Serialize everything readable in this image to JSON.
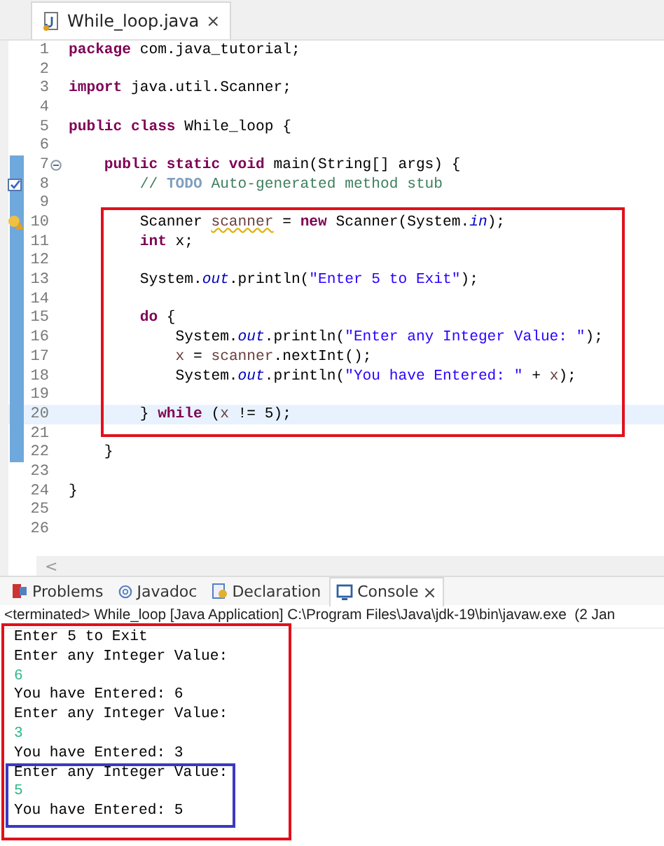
{
  "editor_tab": {
    "label": "While_loop.java",
    "close": "×"
  },
  "code_lines": [
    {
      "number": "1",
      "current": false,
      "kind": "code",
      "tokens": [
        {
          "kind": "kw",
          "text": "package"
        },
        {
          "kind": "plain",
          "text": " com.java_tutorial;"
        }
      ]
    },
    {
      "number": "2",
      "current": false,
      "kind": "code"
    },
    {
      "number": "3",
      "current": false,
      "kind": "code",
      "tokens": [
        {
          "kind": "kw",
          "text": "import"
        },
        {
          "kind": "plain",
          "text": " java.util.Scanner;"
        }
      ]
    },
    {
      "number": "4",
      "current": false,
      "kind": "code"
    },
    {
      "number": "5",
      "current": false,
      "kind": "code",
      "tokens": [
        {
          "kind": "kw",
          "text": "public class"
        },
        {
          "kind": "plain",
          "text": " While_loop {"
        }
      ]
    },
    {
      "number": "6",
      "current": false,
      "kind": "code"
    },
    {
      "number": "7",
      "current": false,
      "kind": "fold",
      "tokens": [
        {
          "kind": "kw",
          "text": "    public static void"
        },
        {
          "kind": "plain",
          "text": " main(String[] args) {"
        }
      ]
    },
    {
      "number": "8",
      "current": false,
      "kind": "task",
      "tokens": [
        {
          "kind": "comment",
          "text": "        // "
        },
        {
          "kind": "todo",
          "text": "TODO"
        },
        {
          "kind": "comment",
          "text": " Auto-generated method stub"
        }
      ]
    },
    {
      "number": "9",
      "current": false,
      "kind": "code"
    },
    {
      "number": "10",
      "current": false,
      "kind": "warning",
      "tokens": [
        {
          "kind": "plain",
          "text": "        Scanner "
        },
        {
          "kind": "warn",
          "text": "scanner"
        },
        {
          "kind": "plain",
          "text": " = "
        },
        {
          "kind": "kw",
          "text": "new"
        },
        {
          "kind": "plain",
          "text": " Scanner(System."
        },
        {
          "kind": "static",
          "text": "in"
        },
        {
          "kind": "plain",
          "text": ");"
        }
      ]
    },
    {
      "number": "11",
      "current": false,
      "kind": "code",
      "tokens": [
        {
          "kind": "kw",
          "text": "        int"
        },
        {
          "kind": "plain",
          "text": " x;"
        }
      ]
    },
    {
      "number": "12",
      "current": false,
      "kind": "code"
    },
    {
      "number": "13",
      "current": false,
      "kind": "code",
      "tokens": [
        {
          "kind": "plain",
          "text": "        System."
        },
        {
          "kind": "static",
          "text": "out"
        },
        {
          "kind": "plain",
          "text": ".println("
        },
        {
          "kind": "str",
          "text": "\"Enter 5 to Exit\""
        },
        {
          "kind": "plain",
          "text": ");"
        }
      ]
    },
    {
      "number": "14",
      "current": false,
      "kind": "code"
    },
    {
      "number": "15",
      "current": false,
      "kind": "code",
      "tokens": [
        {
          "kind": "kw",
          "text": "        do"
        },
        {
          "kind": "plain",
          "text": " {"
        }
      ]
    },
    {
      "number": "16",
      "current": false,
      "kind": "code",
      "tokens": [
        {
          "kind": "plain",
          "text": "            System."
        },
        {
          "kind": "static",
          "text": "out"
        },
        {
          "kind": "plain",
          "text": ".println("
        },
        {
          "kind": "str",
          "text": "\"Enter any Integer Value: \""
        },
        {
          "kind": "plain",
          "text": ");"
        }
      ]
    },
    {
      "number": "17",
      "current": false,
      "kind": "code",
      "tokens": [
        {
          "kind": "local",
          "text": "            x"
        },
        {
          "kind": "plain",
          "text": " = "
        },
        {
          "kind": "local",
          "text": "scanner"
        },
        {
          "kind": "plain",
          "text": ".nextInt();"
        }
      ]
    },
    {
      "number": "18",
      "current": false,
      "kind": "code",
      "tokens": [
        {
          "kind": "plain",
          "text": "            System."
        },
        {
          "kind": "static",
          "text": "out"
        },
        {
          "kind": "plain",
          "text": ".println("
        },
        {
          "kind": "str",
          "text": "\"You have Entered: \""
        },
        {
          "kind": "plain",
          "text": " + "
        },
        {
          "kind": "local",
          "text": "x"
        },
        {
          "kind": "plain",
          "text": ");"
        }
      ]
    },
    {
      "number": "19",
      "current": false,
      "kind": "code"
    },
    {
      "number": "20",
      "current": true,
      "kind": "code",
      "tokens": [
        {
          "kind": "plain",
          "text": "        } "
        },
        {
          "kind": "kw",
          "text": "while"
        },
        {
          "kind": "plain",
          "text": " ("
        },
        {
          "kind": "local",
          "text": "x"
        },
        {
          "kind": "plain",
          "text": " != 5);"
        }
      ]
    },
    {
      "number": "21",
      "current": false,
      "kind": "code"
    },
    {
      "number": "22",
      "current": false,
      "kind": "code",
      "tokens": [
        {
          "kind": "plain",
          "text": "    }"
        }
      ]
    },
    {
      "number": "23",
      "current": false,
      "kind": "code"
    },
    {
      "number": "24",
      "current": false,
      "kind": "code",
      "tokens": [
        {
          "kind": "plain",
          "text": "}"
        }
      ]
    },
    {
      "number": "25",
      "current": false,
      "kind": "code"
    },
    {
      "number": "26",
      "current": false,
      "kind": "code"
    }
  ],
  "scroll_left": "<",
  "view_tabs": [
    {
      "label": "Problems",
      "selected": false
    },
    {
      "label": "Javadoc",
      "selected": false
    },
    {
      "label": "Declaration",
      "selected": false
    },
    {
      "label": "Console",
      "selected": true,
      "close": "×"
    }
  ],
  "console_header": "<terminated> While_loop [Java Application] C:\\Program Files\\Java\\jdk-19\\bin\\javaw.exe  (2 Jan",
  "console_lines": [
    {
      "kind": "output",
      "text": "Enter 5 to Exit"
    },
    {
      "kind": "output",
      "text": "Enter any Integer Value:"
    },
    {
      "kind": "input",
      "text": "6"
    },
    {
      "kind": "output",
      "text": "You have Entered: 6"
    },
    {
      "kind": "output",
      "text": "Enter any Integer Value:"
    },
    {
      "kind": "input",
      "text": "3"
    },
    {
      "kind": "output",
      "text": "You have Entered: 3"
    },
    {
      "kind": "output",
      "text": "Enter any Integer Value:"
    },
    {
      "kind": "input",
      "text": "5"
    },
    {
      "kind": "output",
      "text": "You have Entered: 5"
    }
  ]
}
